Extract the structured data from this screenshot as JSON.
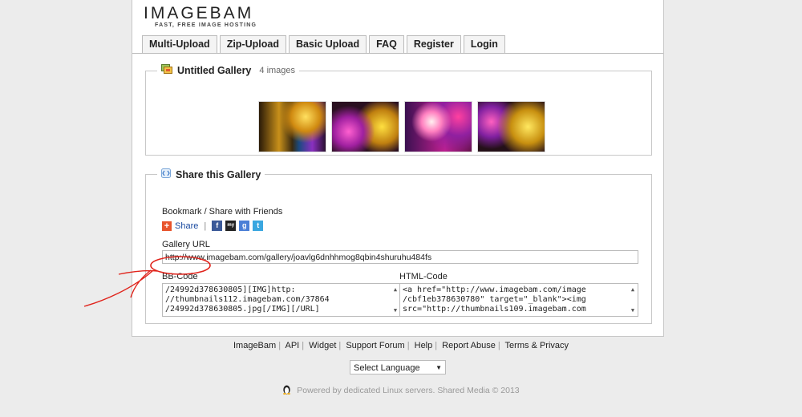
{
  "logo": {
    "title": "IMAGEBAM",
    "tagline": "FAST, FREE IMAGE HOSTING"
  },
  "tabs": [
    {
      "label": "Multi-Upload"
    },
    {
      "label": "Zip-Upload"
    },
    {
      "label": "Basic Upload"
    },
    {
      "label": "FAQ"
    },
    {
      "label": "Register"
    },
    {
      "label": "Login"
    }
  ],
  "gallery": {
    "title": "Untitled Gallery",
    "count": "4 images",
    "thumbnails": [
      "thumbnail-1",
      "thumbnail-2",
      "thumbnail-3",
      "thumbnail-4"
    ]
  },
  "share": {
    "title": "Share this Gallery",
    "bookmark_label": "Bookmark / Share with Friends",
    "share_label": "Share",
    "share_sep": "|",
    "social": [
      {
        "name": "facebook-icon",
        "glyph": "f",
        "color": "#3b5998"
      },
      {
        "name": "myspace-icon",
        "glyph": "my",
        "color": "#222222"
      },
      {
        "name": "google-icon",
        "glyph": "g",
        "color": "#4a7fd6"
      },
      {
        "name": "twitter-icon",
        "glyph": "t",
        "color": "#3aa7e0"
      }
    ],
    "gallery_url_label": "Gallery URL",
    "gallery_url_value": "http://www.imagebam.com/gallery/joavlg6dnhhmog8qbin4shuruhu484fs",
    "bbcode_label": "BB-Code",
    "bbcode_value": "/24992d378630805][IMG]http:\n//thumbnails112.imagebam.com/37864\n/24992d378630805.jpg[/IMG][/URL]",
    "htmlcode_label": "HTML-Code",
    "htmlcode_value": "<a href=\"http://www.imagebam.com/image\n/cbf1eb378630780\" target=\"_blank\"><img\nsrc=\"http://thumbnails109.imagebam.com"
  },
  "footer": {
    "links": [
      "ImageBam",
      "API",
      "Widget",
      "Support Forum",
      "Help",
      "Report Abuse",
      "Terms & Privacy"
    ],
    "language": "Select Language",
    "powered": "Powered by dedicated Linux servers. Shared Media © 2013"
  },
  "colors": {
    "accent_red": "#e0241c",
    "share_orange": "#e8542c"
  }
}
